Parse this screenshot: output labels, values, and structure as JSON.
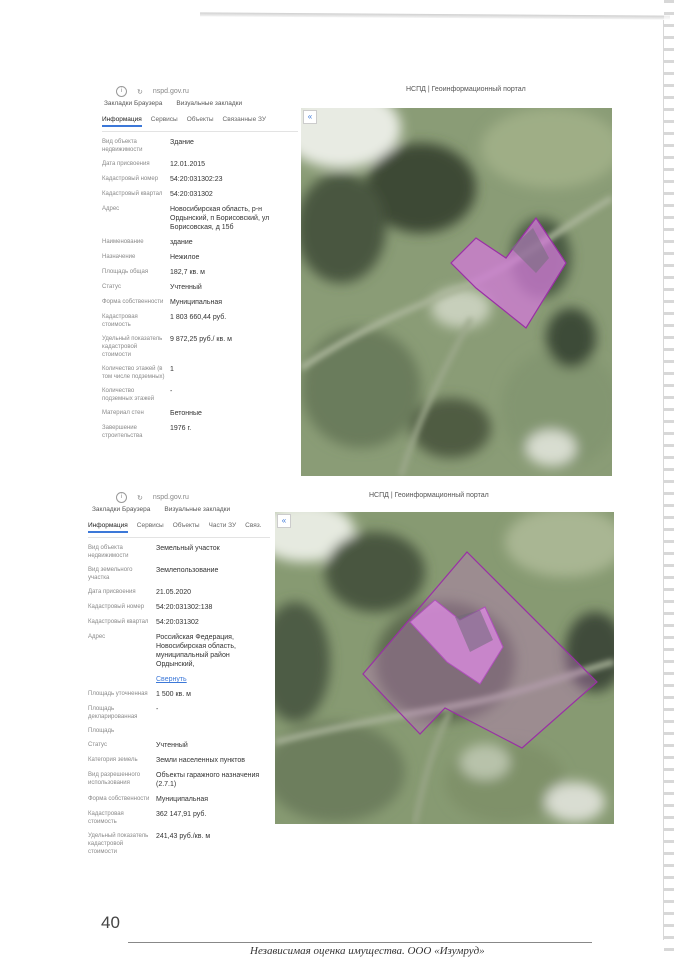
{
  "page": {
    "number": "40",
    "footer": "Независимая оценка имущества. ООО «Изумруд»"
  },
  "shot1": {
    "url": "nspd.gov.ru",
    "toolbar": [
      "Закладки Браузера",
      "Визуальные закладки"
    ],
    "portal_title": "НСПД | Геоинформационный портал",
    "tabs": [
      "Информация",
      "Сервисы",
      "Объекты",
      "Связанные ЗУ"
    ],
    "rows": [
      {
        "label": "Вид объекта недвижимости",
        "value": "Здание"
      },
      {
        "label": "Дата присвоения",
        "value": "12.01.2015"
      },
      {
        "label": "Кадастровый номер",
        "value": "54:20:031302:23"
      },
      {
        "label": "Кадастровый квартал",
        "value": "54:20:031302"
      },
      {
        "label": "Адрес",
        "value": "Новосибирская область, р-н Ордынский, п Борисовский, ул Борисовская, д 15б"
      },
      {
        "label": "Наименование",
        "value": "здание"
      },
      {
        "label": "Назначение",
        "value": "Нежилое"
      },
      {
        "label": "Площадь общая",
        "value": "182,7 кв. м"
      },
      {
        "label": "Статус",
        "value": "Учтенный"
      },
      {
        "label": "Форма собственности",
        "value": "Муниципальная"
      },
      {
        "label": "Кадастровая стоимость",
        "value": "1 803 660,44 руб."
      },
      {
        "label": "Удельный показатель кадастровой стоимости",
        "value": "9 872,25 руб./ кв. м"
      },
      {
        "label": "Количество этажей (в том числе подземных)",
        "value": "1"
      },
      {
        "label": "Количество подземных этажей",
        "value": "-"
      },
      {
        "label": "Материал стен",
        "value": "Бетонные"
      },
      {
        "label": "Завершение строительства",
        "value": "1976 г."
      }
    ]
  },
  "shot2": {
    "url": "nspd.gov.ru",
    "toolbar": [
      "Закладки Браузера",
      "Визуальные закладки"
    ],
    "portal_title": "НСПД | Геоинформационный портал",
    "tabs": [
      "Информация",
      "Сервисы",
      "Объекты",
      "Части ЗУ",
      "Связ."
    ],
    "rows": [
      {
        "label": "Вид объекта недвижимости",
        "value": "Земельный участок"
      },
      {
        "label": "Вид земельного участка",
        "value": "Землепользование"
      },
      {
        "label": "Дата присвоения",
        "value": "21.05.2020"
      },
      {
        "label": "Кадастровый номер",
        "value": "54:20:031302:138"
      },
      {
        "label": "Кадастровый квартал",
        "value": "54:20:031302"
      },
      {
        "label": "Адрес",
        "value": "Российская Федерация, Новосибирская область, муниципальный район Ордынский,"
      },
      {
        "label": "",
        "value": "Свернуть",
        "link": true
      },
      {
        "label": "Площадь уточненная",
        "value": "1 500 кв. м"
      },
      {
        "label": "Площадь декларированная",
        "value": "-"
      },
      {
        "label": "Площадь",
        "value": ""
      },
      {
        "label": "Статус",
        "value": "Учтенный"
      },
      {
        "label": "Категория земель",
        "value": "Земли населенных пунктов"
      },
      {
        "label": "Вид разрешенного использования",
        "value": "Объекты гаражного назначения (2.7.1)"
      },
      {
        "label": "Форма собственности",
        "value": "Муниципальная"
      },
      {
        "label": "Кадастровая стоимость",
        "value": "362 147,91 руб."
      },
      {
        "label": "Удельный показатель кадастровой стоимости",
        "value": "241,43 руб./кв. м"
      }
    ]
  },
  "colors": {
    "parcel_fill": "#d27ad8",
    "parcel_stroke": "#9a2fa6",
    "grass": "#7c9168",
    "accent": "#3c78d8"
  },
  "icons": [
    "info-icon",
    "reload-icon",
    "collapse-icon"
  ]
}
